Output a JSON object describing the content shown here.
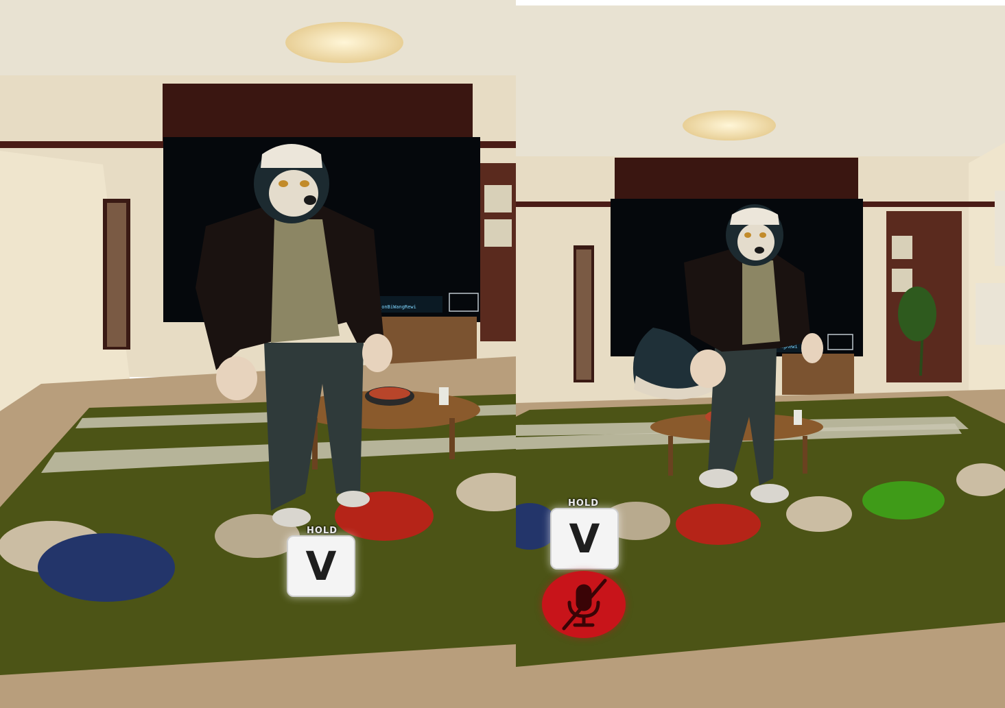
{
  "views": [
    {
      "id": "left-eye",
      "tv_text": "_onBiWangRewi",
      "push_to_talk": {
        "hold_label": "HOLD",
        "key": "V"
      },
      "mic_muted": false
    },
    {
      "id": "right-eye",
      "tv_text": "MangRewi",
      "push_to_talk": {
        "hold_label": "HOLD",
        "key": "V"
      },
      "mic_muted": true,
      "mute_icon": "microphone-muted-icon"
    }
  ],
  "colors": {
    "mute_badge": "#c8141a",
    "rug": "#4c5416",
    "wall": "#efe7d6",
    "accent_wall": "#3a1611",
    "cushion_red": "#b52418",
    "cushion_blue": "#23356a",
    "cushion_green": "#3f9b18",
    "cushion_beige": "#cbbda3"
  }
}
